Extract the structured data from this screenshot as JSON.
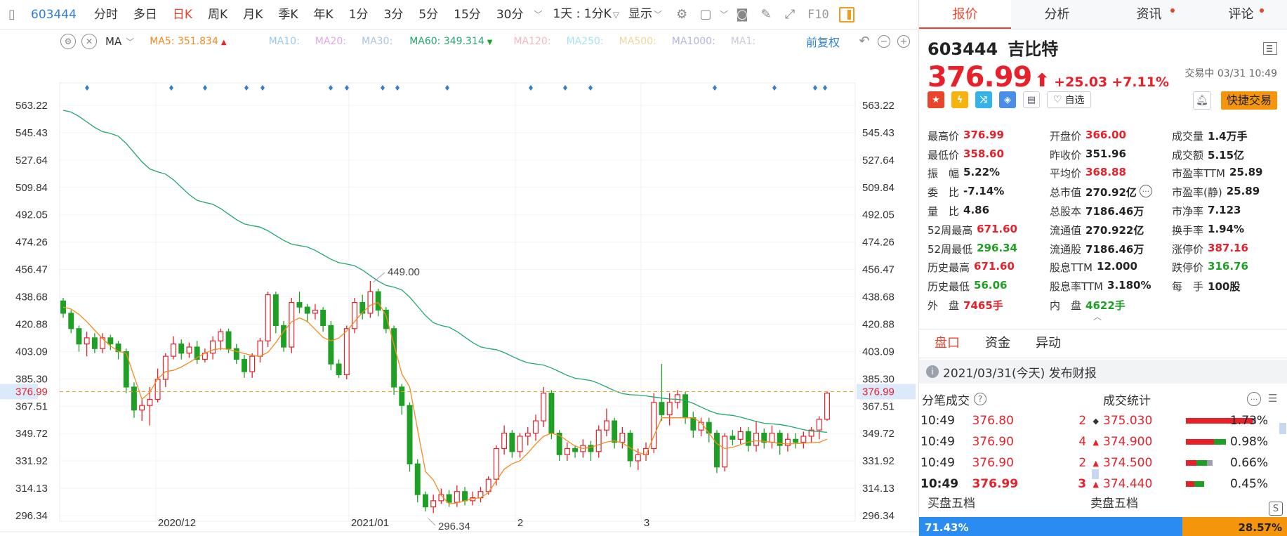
{
  "toolbar": {
    "stock_code": "603444",
    "periods": [
      "分时",
      "多日",
      "日K",
      "周K",
      "月K",
      "季K",
      "年K",
      "1分",
      "3分",
      "5分",
      "15分",
      "30分"
    ],
    "active_period": "日K",
    "range_select": "1天 : 1分K",
    "display_label": "显示",
    "f10_label": "F10"
  },
  "ma_bar": {
    "label": "MA",
    "items": [
      {
        "name": "MA5",
        "value": "351.834",
        "color": "#f58a1f",
        "trend": "up"
      },
      {
        "name": "MA10",
        "value": "",
        "color": "#9bc8f2",
        "trend": ""
      },
      {
        "name": "MA20",
        "value": "",
        "color": "#e3a8e8",
        "trend": ""
      },
      {
        "name": "MA30",
        "value": "",
        "color": "#a9c4e6",
        "trend": ""
      },
      {
        "name": "MA60",
        "value": "349.314",
        "color": "#20a86a",
        "trend": "down"
      },
      {
        "name": "MA120",
        "value": "",
        "color": "#f5b7c4",
        "trend": ""
      },
      {
        "name": "MA250",
        "value": "",
        "color": "#a9e3f2",
        "trend": ""
      },
      {
        "name": "MA500",
        "value": "",
        "color": "#f2d79c",
        "trend": ""
      },
      {
        "name": "MA1000",
        "value": "",
        "color": "#b4b4e8",
        "trend": ""
      },
      {
        "name": "MA1",
        "value": "",
        "color": "#c8c8d8",
        "trend": ""
      }
    ],
    "restore_label": "前复权"
  },
  "chart_data": {
    "type": "candlestick",
    "ylim": [
      290,
      575
    ],
    "y_ticks": [
      "563.22",
      "545.43",
      "527.64",
      "509.84",
      "492.05",
      "474.26",
      "456.47",
      "438.68",
      "420.88",
      "403.09",
      "385.30",
      "367.51",
      "349.72",
      "331.92",
      "314.13",
      "296.34"
    ],
    "x_labels": [
      "2020/12",
      "2021/01",
      "2",
      "3"
    ],
    "current_price": "376.99",
    "annotations": [
      {
        "text": "449.00",
        "value": 449.0
      },
      {
        "text": "296.34",
        "value": 296.34
      }
    ],
    "candles": [
      [
        436,
        428,
        438,
        425
      ],
      [
        428,
        418,
        430,
        415
      ],
      [
        418,
        408,
        420,
        403
      ],
      [
        408,
        412,
        416,
        400
      ],
      [
        412,
        405,
        415,
        402
      ],
      [
        405,
        412,
        415,
        402
      ],
      [
        412,
        408,
        414,
        404
      ],
      [
        408,
        403,
        410,
        398
      ],
      [
        403,
        380,
        405,
        376
      ],
      [
        380,
        365,
        383,
        360
      ],
      [
        365,
        368,
        372,
        358
      ],
      [
        368,
        372,
        380,
        355
      ],
      [
        372,
        385,
        392,
        370
      ],
      [
        385,
        400,
        402,
        380
      ],
      [
        400,
        408,
        413,
        398
      ],
      [
        408,
        402,
        411,
        398
      ],
      [
        402,
        406,
        409,
        399
      ],
      [
        406,
        398,
        410,
        395
      ],
      [
        398,
        402,
        405,
        396
      ],
      [
        402,
        410,
        413,
        398
      ],
      [
        410,
        416,
        418,
        404
      ],
      [
        416,
        405,
        418,
        402
      ],
      [
        405,
        398,
        408,
        395
      ],
      [
        398,
        390,
        401,
        386
      ],
      [
        390,
        400,
        402,
        386
      ],
      [
        400,
        410,
        412,
        396
      ],
      [
        410,
        440,
        442,
        406
      ],
      [
        440,
        420,
        442,
        415
      ],
      [
        420,
        406,
        423,
        403
      ],
      [
        406,
        435,
        438,
        402
      ],
      [
        435,
        432,
        442,
        428
      ],
      [
        432,
        428,
        434,
        422
      ],
      [
        428,
        430,
        434,
        424
      ],
      [
        430,
        420,
        432,
        416
      ],
      [
        420,
        395,
        423,
        391
      ],
      [
        395,
        388,
        398,
        386
      ],
      [
        388,
        418,
        420,
        385
      ],
      [
        418,
        435,
        438,
        415
      ],
      [
        435,
        428,
        440,
        424
      ],
      [
        428,
        442,
        449,
        425
      ],
      [
        442,
        430,
        444,
        426
      ],
      [
        430,
        418,
        432,
        415
      ],
      [
        418,
        380,
        420,
        375
      ],
      [
        380,
        368,
        382,
        362
      ],
      [
        368,
        330,
        370,
        325
      ],
      [
        330,
        310,
        333,
        305
      ],
      [
        310,
        302,
        312,
        299
      ],
      [
        302,
        306,
        310,
        298
      ],
      [
        306,
        310,
        314,
        304
      ],
      [
        310,
        305,
        313,
        302
      ],
      [
        305,
        312,
        316,
        302
      ],
      [
        312,
        306,
        315,
        303
      ],
      [
        306,
        308,
        312,
        303
      ],
      [
        308,
        312,
        315,
        305
      ],
      [
        312,
        320,
        322,
        310
      ],
      [
        320,
        340,
        342,
        316
      ],
      [
        340,
        350,
        355,
        336
      ],
      [
        350,
        338,
        352,
        334
      ],
      [
        338,
        348,
        350,
        334
      ],
      [
        348,
        350,
        354,
        342
      ],
      [
        350,
        358,
        362,
        345
      ],
      [
        358,
        376,
        380,
        354
      ],
      [
        376,
        350,
        378,
        346
      ],
      [
        350,
        336,
        352,
        332
      ],
      [
        336,
        340,
        344,
        332
      ],
      [
        340,
        338,
        342,
        334
      ],
      [
        338,
        342,
        346,
        334
      ],
      [
        342,
        338,
        345,
        332
      ],
      [
        338,
        352,
        355,
        334
      ],
      [
        352,
        358,
        366,
        348
      ],
      [
        358,
        344,
        360,
        340
      ],
      [
        344,
        350,
        354,
        340
      ],
      [
        350,
        332,
        352,
        328
      ],
      [
        332,
        336,
        340,
        326
      ],
      [
        336,
        340,
        344,
        332
      ],
      [
        340,
        370,
        376,
        337
      ],
      [
        370,
        362,
        395,
        358
      ],
      [
        362,
        370,
        376,
        355
      ],
      [
        370,
        375,
        378,
        366
      ],
      [
        375,
        360,
        377,
        356
      ],
      [
        360,
        352,
        364,
        347
      ],
      [
        352,
        357,
        360,
        348
      ],
      [
        357,
        350,
        360,
        344
      ],
      [
        350,
        328,
        352,
        324
      ],
      [
        328,
        348,
        350,
        325
      ],
      [
        348,
        346,
        352,
        342
      ],
      [
        346,
        351,
        354,
        343
      ],
      [
        351,
        342,
        354,
        338
      ],
      [
        342,
        350,
        358,
        338
      ],
      [
        350,
        344,
        353,
        340
      ],
      [
        344,
        350,
        355,
        340
      ],
      [
        350,
        342,
        352,
        336
      ],
      [
        342,
        346,
        350,
        338
      ],
      [
        346,
        344,
        350,
        340
      ],
      [
        344,
        348,
        351,
        340
      ],
      [
        348,
        352,
        354,
        344
      ],
      [
        352,
        359,
        361,
        346
      ],
      [
        359,
        376,
        377,
        358
      ]
    ],
    "ma5_anchor": [
      [
        0,
        432
      ],
      [
        8,
        402
      ],
      [
        10,
        372
      ],
      [
        13,
        390
      ],
      [
        20,
        405
      ],
      [
        25,
        400
      ],
      [
        30,
        425
      ],
      [
        34,
        410
      ],
      [
        40,
        435
      ],
      [
        44,
        380
      ],
      [
        46,
        325
      ],
      [
        49,
        304
      ],
      [
        53,
        308
      ],
      [
        57,
        330
      ],
      [
        62,
        350
      ],
      [
        66,
        340
      ],
      [
        70,
        345
      ],
      [
        74,
        336
      ],
      [
        76,
        360
      ],
      [
        80,
        360
      ],
      [
        84,
        340
      ],
      [
        88,
        345
      ],
      [
        92,
        343
      ],
      [
        96,
        344
      ],
      [
        99,
        352
      ]
    ],
    "ma60_anchor": [
      [
        0,
        560
      ],
      [
        6,
        545
      ],
      [
        12,
        520
      ],
      [
        18,
        500
      ],
      [
        24,
        485
      ],
      [
        30,
        472
      ],
      [
        36,
        460
      ],
      [
        42,
        445
      ],
      [
        48,
        420
      ],
      [
        54,
        405
      ],
      [
        60,
        395
      ],
      [
        66,
        385
      ],
      [
        72,
        375
      ],
      [
        78,
        372
      ],
      [
        84,
        362
      ],
      [
        90,
        356
      ],
      [
        96,
        351
      ],
      [
        99,
        349
      ]
    ]
  },
  "panel": {
    "tabs": [
      "报价",
      "分析",
      "资讯",
      "评论"
    ],
    "active_tab": "报价",
    "stock_code": "603444",
    "stock_name": "吉比特",
    "price": "376.99",
    "change": "+25.03",
    "change_pct": "+7.11%",
    "trade_status": "交易中 03/31 10:49",
    "watch_label": "自选",
    "fast_trade_label": "快捷交易",
    "stats": [
      [
        {
          "k": "最高价",
          "v": "376.99",
          "c": "up"
        },
        {
          "k": "开盘价",
          "v": "366.00",
          "c": "up"
        },
        {
          "k": "成交量",
          "v": "1.4万手",
          "c": ""
        }
      ],
      [
        {
          "k": "最低价",
          "v": "358.60",
          "c": "up"
        },
        {
          "k": "昨收价",
          "v": "351.96",
          "c": ""
        },
        {
          "k": "成交额",
          "v": "5.15亿",
          "c": ""
        }
      ],
      [
        {
          "k": "振　幅",
          "v": "5.22%",
          "c": ""
        },
        {
          "k": "平均价",
          "v": "368.88",
          "c": "up"
        },
        {
          "k": "市盈率TTM",
          "v": "25.89",
          "c": ""
        }
      ],
      [
        {
          "k": "委　比",
          "v": "-7.14%",
          "c": ""
        },
        {
          "k": "总市值",
          "v": "270.92亿",
          "c": "",
          "more": true
        },
        {
          "k": "市盈率(静)",
          "v": "25.89",
          "c": ""
        }
      ],
      [
        {
          "k": "量　比",
          "v": "4.86",
          "c": ""
        },
        {
          "k": "总股本",
          "v": "7186.46万",
          "c": ""
        },
        {
          "k": "市净率",
          "v": "7.123",
          "c": ""
        }
      ],
      [
        {
          "k": "52周最高",
          "v": "671.60",
          "c": "up"
        },
        {
          "k": "流通值",
          "v": "270.922亿",
          "c": ""
        },
        {
          "k": "换手率",
          "v": "1.94%",
          "c": ""
        }
      ],
      [
        {
          "k": "52周最低",
          "v": "296.34",
          "c": "down"
        },
        {
          "k": "流通股",
          "v": "7186.46万",
          "c": ""
        },
        {
          "k": "涨停价",
          "v": "387.16",
          "c": "up"
        }
      ],
      [
        {
          "k": "历史最高",
          "v": "671.60",
          "c": "up"
        },
        {
          "k": "股息TTM",
          "v": "12.000",
          "c": ""
        },
        {
          "k": "跌停价",
          "v": "316.76",
          "c": "down"
        }
      ],
      [
        {
          "k": "历史最低",
          "v": "56.06",
          "c": "down"
        },
        {
          "k": "股息率TTM",
          "v": "3.180%",
          "c": ""
        },
        {
          "k": "每　手",
          "v": "100股",
          "c": ""
        }
      ],
      [
        {
          "k": "外　盘",
          "v": "7465手",
          "c": "up"
        },
        {
          "k": "内　盘",
          "v": "4622手",
          "c": "down"
        },
        {
          "k": "",
          "v": "",
          "c": ""
        }
      ]
    ],
    "sub_tabs": [
      "盘口",
      "资金",
      "异动"
    ],
    "active_sub_tab": "盘口",
    "notice": "2021/03/31(今天) 发布财报",
    "tick_title": "分笔成交",
    "ticks": [
      {
        "time": "10:49",
        "price": "376.80",
        "vol": "2",
        "dir": "neutral"
      },
      {
        "time": "10:49",
        "price": "376.90",
        "vol": "4",
        "dir": "up"
      },
      {
        "time": "10:49",
        "price": "376.90",
        "vol": "2",
        "dir": "up"
      },
      {
        "time": "10:49",
        "price": "376.99",
        "vol": "3",
        "dir": "up"
      }
    ],
    "volstat_title": "成交统计",
    "volstats": [
      {
        "price": "375.030",
        "pct": "1.73%",
        "red_share": 0.95,
        "green_share": 0,
        "grey_share": 0.05,
        "bar_frac": 1.0
      },
      {
        "price": "374.900",
        "pct": "0.98%",
        "red_share": 0.7,
        "green_share": 0.3,
        "grey_share": 0,
        "bar_frac": 0.57
      },
      {
        "price": "374.500",
        "pct": "0.66%",
        "red_share": 0.4,
        "green_share": 0.4,
        "grey_share": 0.2,
        "bar_frac": 0.38
      },
      {
        "price": "374.440",
        "pct": "0.45%",
        "red_share": 0.45,
        "green_share": 0.55,
        "grey_share": 0,
        "bar_frac": 0.26
      }
    ],
    "book_buy_title": "买盘五档",
    "book_sell_title": "卖盘五档",
    "buy_ratio": "71.43%",
    "sell_ratio": "28.57%",
    "buy_ratio_frac": 0.7143
  }
}
